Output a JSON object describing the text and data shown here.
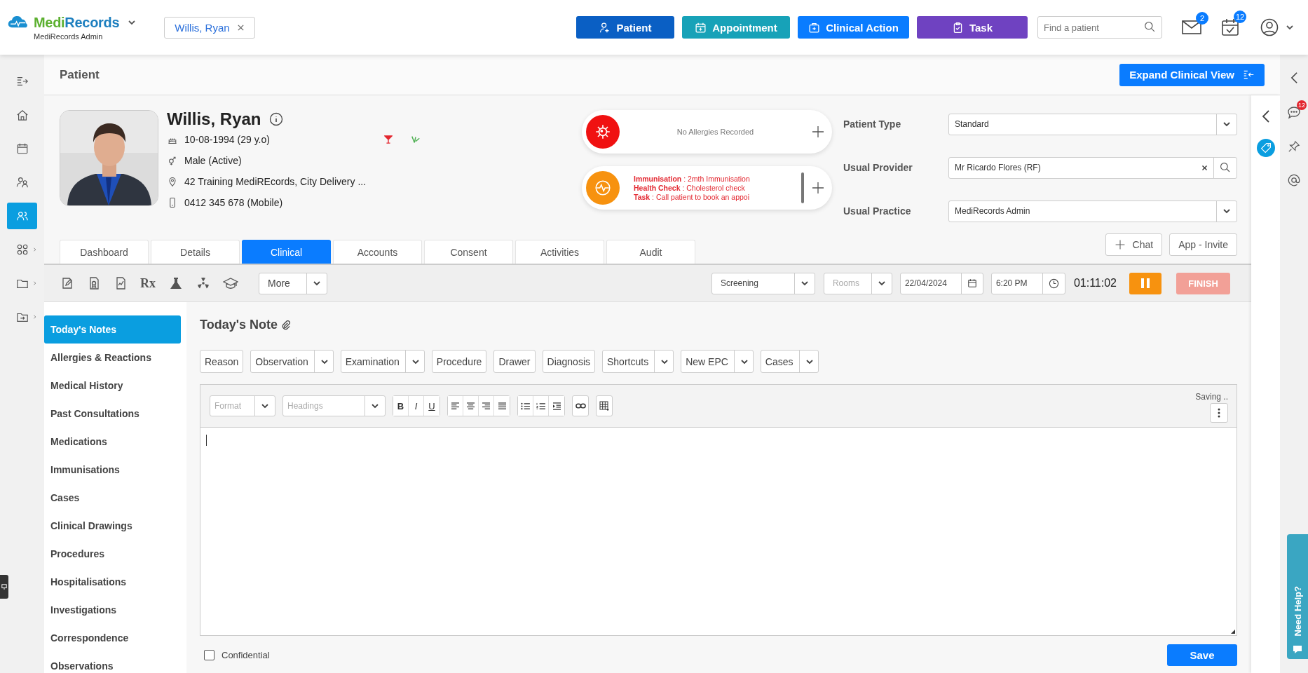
{
  "header": {
    "logo_first": "Medi",
    "logo_second": "Records",
    "practice": "MediRecords Admin",
    "patient_chip": "Willis, Ryan",
    "actions": [
      {
        "label": "Patient",
        "color": "#0a5fc4"
      },
      {
        "label": "Appointment",
        "color": "#17a2b8"
      },
      {
        "label": "Clinical Action",
        "color": "#0a7cff"
      },
      {
        "label": "Task",
        "color": "#6f42c1"
      }
    ],
    "search": {
      "placeholder": "Find a patient"
    },
    "mail_count": "2",
    "task_count": "12"
  },
  "rail": [
    {
      "selected": false,
      "submenu": false
    },
    {
      "selected": false,
      "submenu": false
    },
    {
      "selected": false,
      "submenu": false
    },
    {
      "selected": false,
      "submenu": false
    },
    {
      "selected": true,
      "submenu": false
    },
    {
      "selected": false,
      "submenu": true
    },
    {
      "selected": false,
      "submenu": true
    },
    {
      "selected": false,
      "submenu": true
    }
  ],
  "page_title": "Patient",
  "expand_button": "Expand Clinical View",
  "patient": {
    "name": "Willis, Ryan",
    "details": [
      "10-08-1994 (29 y.o)",
      "Male (Active)",
      "42 Training MediREcords, City Delivery ...",
      "0412 345 678 (Mobile)"
    ]
  },
  "alerts": {
    "allergies": "No Allergies Recorded",
    "reminders": [
      "**Immunisation** : 2mth Immunisation",
      "**Health Check** : Cholesterol check",
      "**Task** : Call patient to book an appoi"
    ]
  },
  "fields": [
    {
      "label": "Patient Type",
      "value": "Standard",
      "kind": "select"
    },
    {
      "label": "Usual Provider",
      "value": "Mr Ricardo Flores (RF)",
      "kind": "lookup"
    },
    {
      "label": "Usual Practice",
      "value": "MediRecords Admin",
      "kind": "select"
    }
  ],
  "patient_buttons": [
    "Chat",
    "App - Invite"
  ],
  "tabs": [
    {
      "label": "Dashboard",
      "selected": false
    },
    {
      "label": "Details",
      "selected": false
    },
    {
      "label": "Clinical",
      "selected": true
    },
    {
      "label": "Accounts",
      "selected": false
    },
    {
      "label": "Consent",
      "selected": false
    },
    {
      "label": "Activities",
      "selected": false
    },
    {
      "label": "Audit",
      "selected": false
    }
  ],
  "toolbar": {
    "rx_symbol": "Rx",
    "more": "More",
    "visit_type": "Screening",
    "rooms_placeholder": "Rooms",
    "date": "22/04/2024",
    "time": "6:20 PM",
    "timer": "01:11:02",
    "finish": {
      "label": "FINISH",
      "disabled": true
    }
  },
  "notes_nav": [
    {
      "label": "Today's Notes",
      "selected": true
    },
    {
      "label": "Allergies & Reactions",
      "selected": false
    },
    {
      "label": "Medical History",
      "selected": false
    },
    {
      "label": "Past Consultations",
      "selected": false
    },
    {
      "label": "Medications",
      "selected": false
    },
    {
      "label": "Immunisations",
      "selected": false
    },
    {
      "label": "Cases",
      "selected": false
    },
    {
      "label": "Clinical Drawings",
      "selected": false
    },
    {
      "label": "Procedures",
      "selected": false
    },
    {
      "label": "Hospitalisations",
      "selected": false
    },
    {
      "label": "Investigations",
      "selected": false
    },
    {
      "label": "Correspondence",
      "selected": false
    },
    {
      "label": "Observations",
      "selected": false
    }
  ],
  "note": {
    "title": "Today's Note",
    "quick_buttons": [
      {
        "label": "Reason",
        "kind": "button"
      },
      {
        "label": "Observation",
        "kind": "dropdown"
      },
      {
        "label": "Examination",
        "kind": "dropdown"
      },
      {
        "label": "Procedure",
        "kind": "button"
      },
      {
        "label": "Drawer",
        "kind": "button"
      },
      {
        "label": "Diagnosis",
        "kind": "button"
      },
      {
        "label": "Shortcuts",
        "kind": "dropdown"
      },
      {
        "label": "New EPC",
        "kind": "dropdown"
      },
      {
        "label": "Cases",
        "kind": "dropdown"
      }
    ],
    "format_placeholder": "Format",
    "headings_placeholder": "Headings",
    "text_styles": [
      "B",
      "I",
      "U"
    ],
    "status": "Saving ..",
    "confidential": {
      "label": "Confidential",
      "checked": false
    },
    "save": "Save"
  },
  "side_panel": {
    "chat_count": "12"
  },
  "help": "Need Help?"
}
